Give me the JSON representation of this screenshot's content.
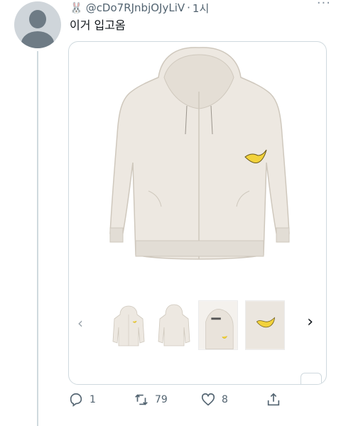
{
  "tweet": {
    "handle": "@cDo7RJnbjOJyLiV",
    "separator": "·",
    "time": "1시",
    "text": "이거 입고옴",
    "more_label": "···"
  },
  "media": {
    "thumbnail_count": 4
  },
  "actions": {
    "reply_count": "1",
    "retweet_count": "79",
    "like_count": "8"
  },
  "colors": {
    "text_primary": "#0f1419",
    "text_secondary": "#536471",
    "border": "#cfd9de",
    "hoodie": "#ede8e1",
    "logo": "#f2d23c"
  }
}
